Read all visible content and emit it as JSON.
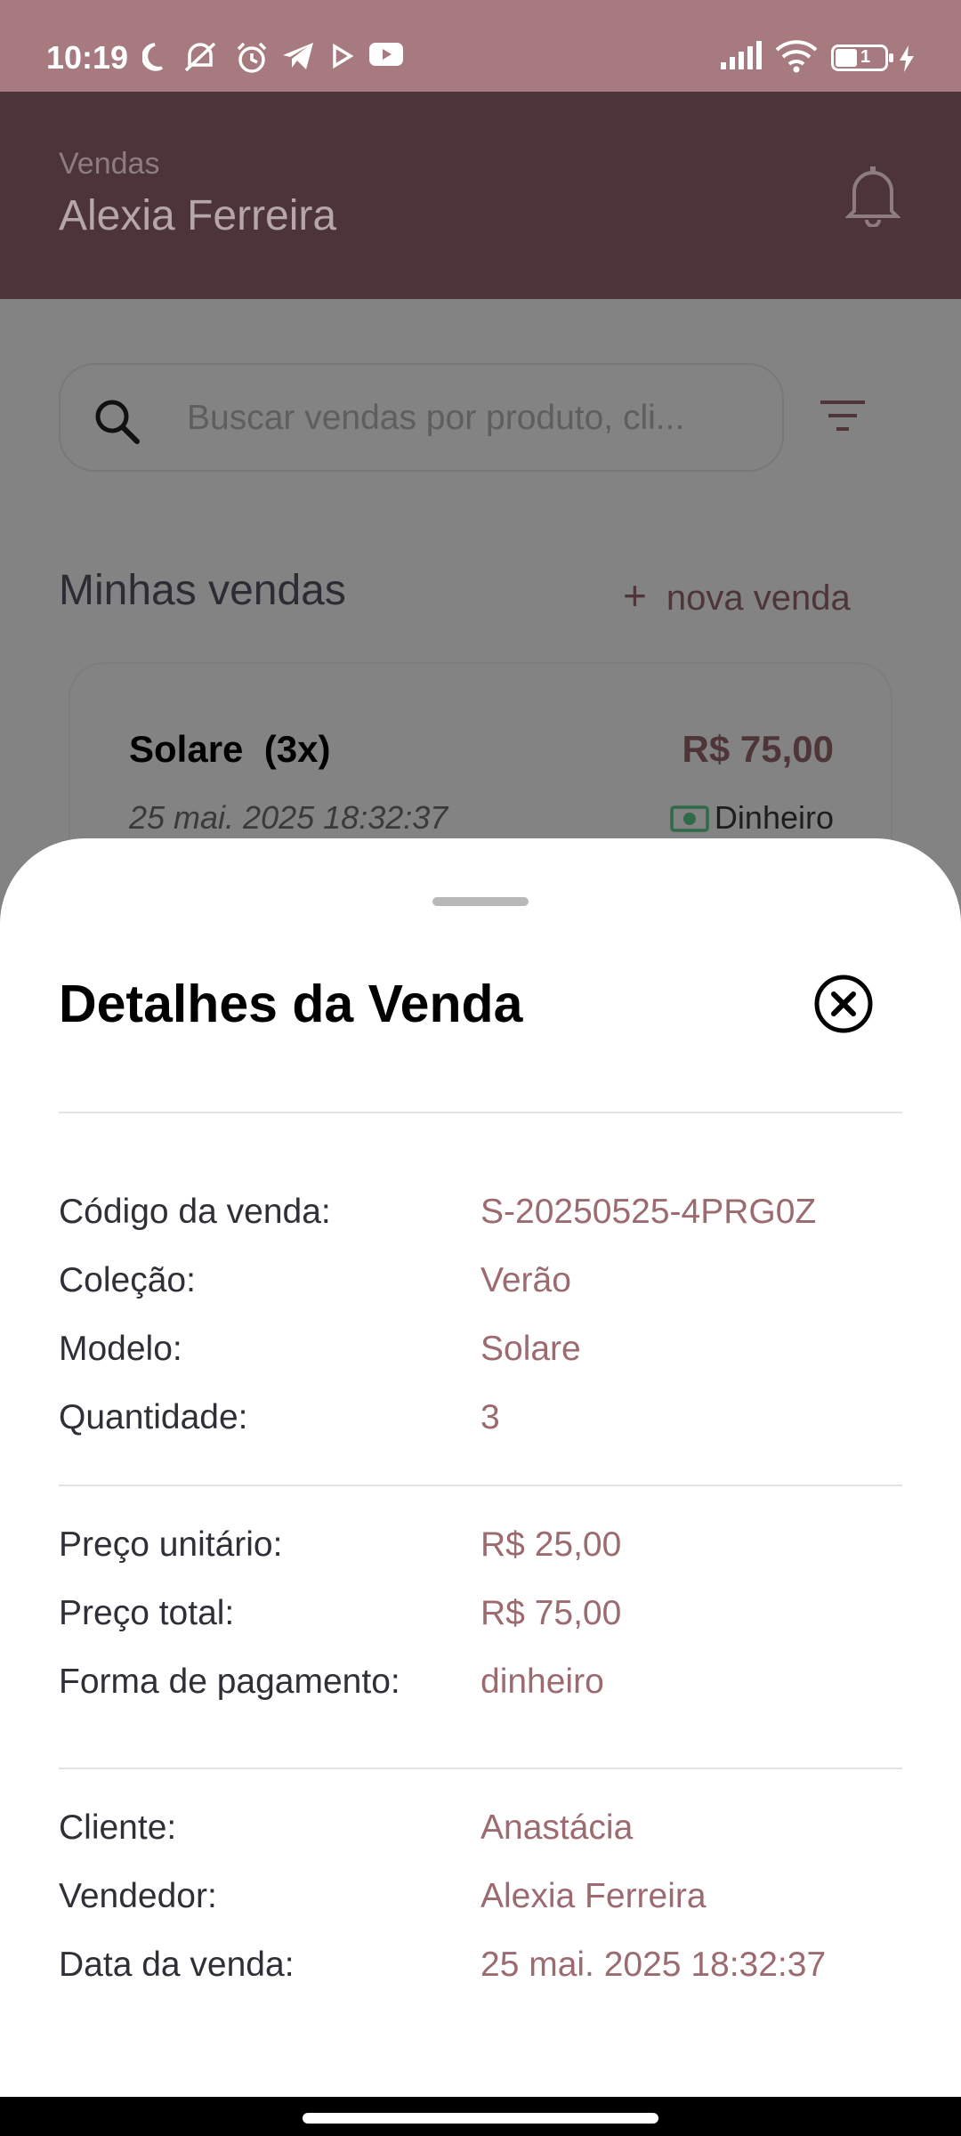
{
  "status_bar": {
    "time": "10:19",
    "icons": [
      "moon-icon",
      "notifications-off-icon",
      "alarm-icon",
      "telegram-icon",
      "play-icon",
      "youtube-icon",
      "signal-icon",
      "wifi-icon",
      "battery-icon",
      "charging-icon"
    ],
    "battery_level": "1"
  },
  "app_bar": {
    "subtitle": "Vendas",
    "title": "Alexia Ferreira",
    "icon": "bell-icon"
  },
  "search": {
    "placeholder": "Buscar vendas por produto, cli..."
  },
  "sales_section": {
    "title": "Minhas vendas",
    "new_sale_label": "nova venda",
    "cards": [
      {
        "product": "Solare",
        "quantity": "(3x)",
        "price": "R$ 75,00",
        "date": "25 mai. 2025 18:32:37",
        "payment": "Dinheiro"
      }
    ]
  },
  "details_sheet": {
    "title": "Detalhes da Venda",
    "groups": [
      [
        {
          "label": "Código da venda:",
          "value": "S-20250525-4PRG0Z"
        },
        {
          "label": "Coleção:",
          "value": "Verão"
        },
        {
          "label": "Modelo:",
          "value": "Solare"
        },
        {
          "label": "Quantidade:",
          "value": "3"
        }
      ],
      [
        {
          "label": "Preço unitário:",
          "value": "R$ 25,00"
        },
        {
          "label": "Preço total:",
          "value": "R$ 75,00"
        },
        {
          "label": "Forma de pagamento:",
          "value": "dinheiro"
        }
      ],
      [
        {
          "label": "Cliente:",
          "value": "Anastácia"
        },
        {
          "label": "Vendedor:",
          "value": "Alexia Ferreira"
        },
        {
          "label": "Data da venda:",
          "value": "25 mai. 2025 18:32:37"
        }
      ]
    ]
  },
  "colors": {
    "status_bar": "#a67a7e",
    "app_bar": "#4c3438",
    "scrim": "#838383",
    "accent_value": "#9b6b70",
    "payment_green": "#2e8b57"
  }
}
